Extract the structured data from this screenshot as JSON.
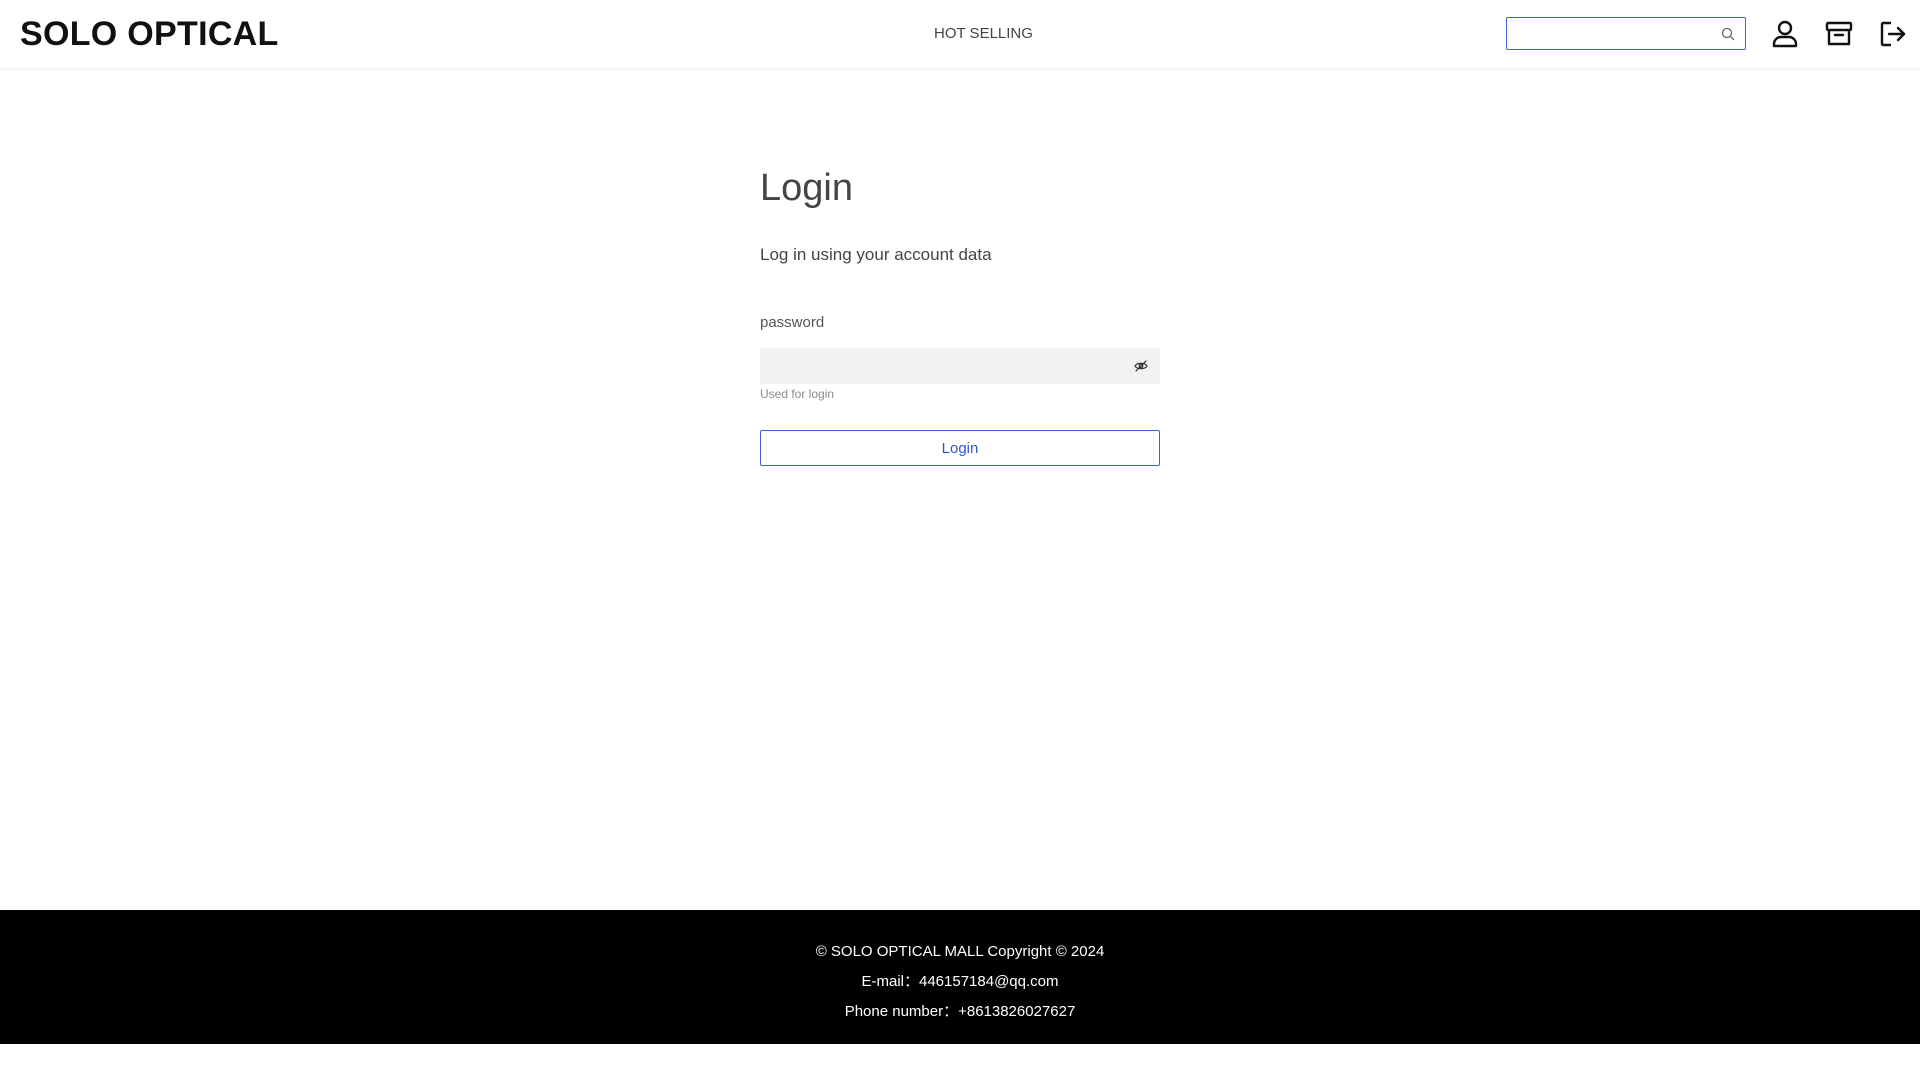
{
  "header": {
    "brand": "SOLO OPTICAL",
    "nav_link": "HOT SELLING",
    "search": {
      "value": "",
      "placeholder": ""
    },
    "icons": [
      "search-icon",
      "user-icon",
      "archive-icon",
      "logout-icon"
    ]
  },
  "login": {
    "title": "Login",
    "subtitle": "Log in using your account data",
    "password_label": "password",
    "password_value": "",
    "password_hint": "Used for login",
    "button_label": "Login"
  },
  "footer": {
    "copyright": "© SOLO OPTICAL MALL Copyright © 2024",
    "email": "E-mail：446157184@qq.com",
    "phone": "Phone number：+8613826027627"
  },
  "colors": {
    "accent": "#3e62d8",
    "footer_bg": "#000000",
    "input_bg": "#f2f2f2"
  }
}
